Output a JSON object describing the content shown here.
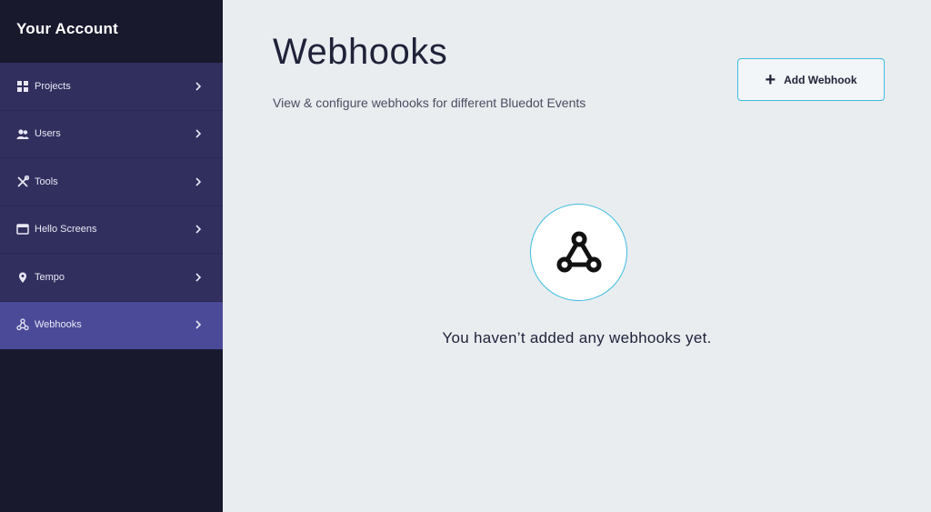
{
  "sidebar": {
    "title": "Your Account",
    "items": [
      {
        "label": "Projects",
        "icon": "grid-icon",
        "active": false
      },
      {
        "label": "Users",
        "icon": "users-icon",
        "active": false
      },
      {
        "label": "Tools",
        "icon": "tools-icon",
        "active": false
      },
      {
        "label": "Hello Screens",
        "icon": "screen-icon",
        "active": false
      },
      {
        "label": "Tempo",
        "icon": "location-pin-icon",
        "active": false
      },
      {
        "label": "Webhooks",
        "icon": "webhook-icon",
        "active": true
      }
    ]
  },
  "main": {
    "title": "Webhooks",
    "subtitle": "View & configure webhooks for different Bluedot Events",
    "add_button_icon": "+",
    "add_button_label": "Add Webhook",
    "empty_state_icon": "webhook-icon",
    "empty_state_text": "You haven’t added any webhooks yet."
  },
  "colors": {
    "sidebar_bg": "#18192d",
    "nav_item_bg": "#312f5e",
    "nav_item_active_bg": "#4b4a99",
    "accent": "#3dbde0",
    "main_bg": "#e9edf0"
  }
}
